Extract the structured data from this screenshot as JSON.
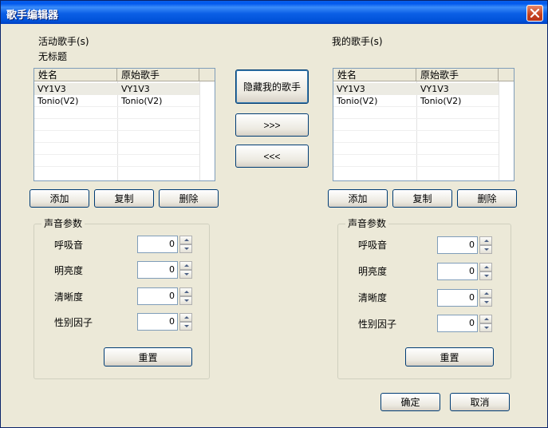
{
  "window": {
    "title": "歌手编辑器"
  },
  "left_panel": {
    "heading": "活动歌手(s)",
    "subheading": "无标题",
    "columns": [
      "姓名",
      "原始歌手"
    ],
    "rows": [
      {
        "name": "VY1V3",
        "original": "VY1V3",
        "selected": true
      },
      {
        "name": "Tonio(V2)",
        "original": "Tonio(V2)",
        "selected": false
      }
    ],
    "buttons": {
      "add": "添加",
      "copy": "复制",
      "delete": "删除"
    },
    "params": {
      "title": "声音参数",
      "items": [
        {
          "label": "呼吸音",
          "value": "0"
        },
        {
          "label": "明亮度",
          "value": "0"
        },
        {
          "label": "清晰度",
          "value": "0"
        },
        {
          "label": "性别因子",
          "value": "0"
        }
      ],
      "reset": "重置"
    }
  },
  "middle": {
    "hide": "隐藏我的歌手",
    "move_right": ">>>",
    "move_left": "<<<"
  },
  "right_panel": {
    "heading": "我的歌手(s)",
    "columns": [
      "姓名",
      "原始歌手"
    ],
    "rows": [
      {
        "name": "VY1V3",
        "original": "VY1V3",
        "selected": true
      },
      {
        "name": "Tonio(V2)",
        "original": "Tonio(V2)",
        "selected": false
      }
    ],
    "buttons": {
      "add": "添加",
      "copy": "复制",
      "delete": "删除"
    },
    "params": {
      "title": "声音参数",
      "items": [
        {
          "label": "呼吸音",
          "value": "0"
        },
        {
          "label": "明亮度",
          "value": "0"
        },
        {
          "label": "清晰度",
          "value": "0"
        },
        {
          "label": "性别因子",
          "value": "0"
        }
      ],
      "reset": "重置"
    }
  },
  "footer": {
    "ok": "确定",
    "cancel": "取消"
  },
  "icons": {
    "close": "close-icon",
    "spin_up": "spin-up-icon",
    "spin_down": "spin-down-icon"
  }
}
